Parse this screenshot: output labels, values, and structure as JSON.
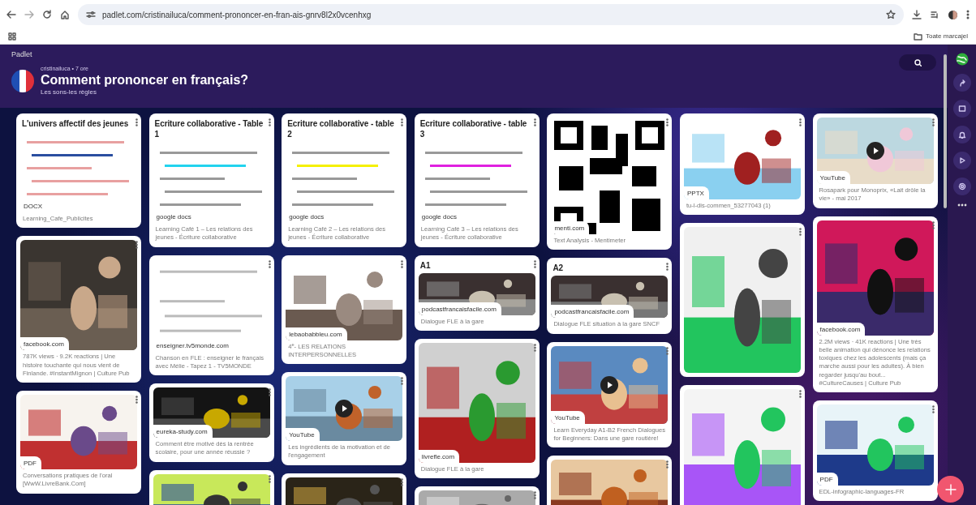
{
  "browser": {
    "url": "padlet.com/cristinailuca/comment-prononcer-en-fran-ais-gnrv8l2x0vcenhxg",
    "bookmarks_folder": "Toate marcajel"
  },
  "padlet": {
    "brand": "Padlet",
    "author_line": "cristinailuca • 7 ore",
    "title": "Comment prononcer en français?",
    "subtitle": "Les sons-les règles"
  },
  "columns": [
    {
      "cards": [
        {
          "title": "L'univers affectif des jeunes",
          "source": "DOCX",
          "caption": "Learning_Cafe_Publicites",
          "playable": false
        },
        {
          "source": "facebook.com",
          "caption": "787K views · 9.2K reactions | Une histoire touchante qui nous vient de Finlande. #InstantMignon | Culture Pub",
          "playable": false
        },
        {
          "source": "PDF",
          "caption": "Conversations pratiques de l'oral [WwW.LivreBank.Com]",
          "playable": false
        }
      ]
    },
    {
      "cards": [
        {
          "title": "Ecriture collaborative - Table 1",
          "source": "google docs",
          "caption": "Learning Café 1 – Les relations des jeunes - Écriture collaborative",
          "playable": false
        },
        {
          "source": "enseigner.tv5monde.com",
          "caption": "Chanson en FLE : enseigner le français avec Mélie - Tapez 1 - TV5MONDE",
          "playable": false
        },
        {
          "source": "eureka-study.com",
          "caption": "Comment être motivé dès la rentrée scolaire, pour une année réussie ?",
          "playable": false
        },
        {
          "playable": false
        }
      ]
    },
    {
      "cards": [
        {
          "title": "Ecriture collaborative - table 2",
          "source": "google docs",
          "caption": "Learning Café 2 – Les relations des jeunes - Écriture collaborative",
          "playable": false
        },
        {
          "source": "lebaobabbleu.com",
          "caption": "4$^{e}$- LES RELATIONS INTERPERSONNELLES",
          "playable": false
        },
        {
          "source": "YouTube",
          "caption": "Les ingrédients de la motivation et de l'engagement",
          "playable": true
        },
        {
          "playable": false
        }
      ]
    },
    {
      "cards": [
        {
          "title": "Ecriture collaborative - table 3",
          "source": "google docs",
          "caption": "Learning Café 3 – Les relations des jeunes - Écriture collaborative",
          "playable": false
        },
        {
          "title": "A1",
          "source": "podcastfrancaisfacile.com",
          "caption": "Dialogue FLE à la gare",
          "playable": false
        },
        {
          "source": "livrefle.com",
          "caption": "Dialogue FLE à la gare",
          "playable": false
        },
        {
          "playable": false
        }
      ]
    },
    {
      "cards": [
        {
          "source": "menti.com",
          "caption": "Text Analysis - Mentimeter",
          "playable": false
        },
        {
          "title": "A2",
          "source": "podcastfrancaisfacile.com",
          "caption": "Dialogue FLE situation à la gare SNCF",
          "playable": false
        },
        {
          "source": "YouTube",
          "caption": "Learn Everyday A1-B2 French Dialogues for Beginners: Dans une gare routière!",
          "playable": true
        },
        {
          "playable": false
        }
      ]
    },
    {
      "cards": [
        {
          "source": "PPTX",
          "caption": "tu-l-dis-commen_53277043 (1)",
          "playable": false
        },
        {
          "playable": false
        },
        {
          "playable": false
        }
      ]
    },
    {
      "cards": [
        {
          "source": "YouTube",
          "caption": "Rosapark pour Monoprix, «Lait drôle la vie» - mai 2017",
          "playable": true
        },
        {
          "source": "facebook.com",
          "caption": "2.2M views · 41K reactions | Une très belle animation qui dénonce les relations toxiques chez les adolescents (mais ça marche aussi pour les adultes). À bien regarder jusqu'au bout... #CultureCauses | Culture Pub",
          "playable": false
        },
        {
          "source": "PDF",
          "caption": "EDL-infographic-languages-FR",
          "playable": false
        }
      ]
    }
  ]
}
